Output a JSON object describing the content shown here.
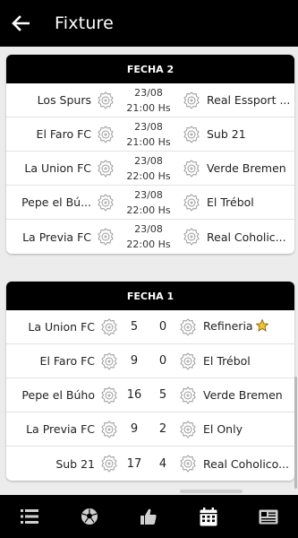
{
  "header": {
    "title": "Fixture",
    "back_icon": "arrow-left-icon"
  },
  "upcoming": {
    "title": "FECHA 2",
    "matches": [
      {
        "home": "Los Spurs",
        "date": "23/08",
        "time": "21:00 Hs",
        "away": "Real Essport ..."
      },
      {
        "home": "El Faro FC",
        "date": "23/08",
        "time": "21:00 Hs",
        "away": "Sub 21"
      },
      {
        "home": "La Union FC",
        "date": "23/08",
        "time": "22:00 Hs",
        "away": "Verde Bremen"
      },
      {
        "home": "Pepe el Bú...",
        "date": "23/08",
        "time": "22:00 Hs",
        "away": "El Trébol"
      },
      {
        "home": "La Previa FC",
        "date": "23/08",
        "time": "22:00 Hs",
        "away": "Real Coholic..."
      }
    ]
  },
  "results": {
    "title": "FECHA 1",
    "matches": [
      {
        "home": "La Union FC",
        "home_score": "5",
        "away_score": "0",
        "away": "Refineria",
        "star": true
      },
      {
        "home": "El Faro FC",
        "home_score": "9",
        "away_score": "0",
        "away": "El Trébol",
        "star": false
      },
      {
        "home": "Pepe el Búho",
        "home_score": "16",
        "away_score": "5",
        "away": "Verde Bremen",
        "star": false
      },
      {
        "home": "La Previa FC",
        "home_score": "9",
        "away_score": "2",
        "away": "El Only",
        "star": false
      },
      {
        "home": "Sub 21",
        "home_score": "17",
        "away_score": "4",
        "away": "Real Coholico...",
        "star": false
      }
    ]
  },
  "nav": {
    "items": [
      {
        "icon": "list-icon",
        "active": false
      },
      {
        "icon": "soccer-ball-icon",
        "active": false
      },
      {
        "icon": "thumbs-up-icon",
        "active": false
      },
      {
        "icon": "calendar-icon",
        "active": true
      },
      {
        "icon": "newspaper-icon",
        "active": false
      }
    ]
  },
  "colors": {
    "header_bg": "#000000",
    "card_bg": "#ffffff",
    "page_bg": "#ececec",
    "star": "#f2c230"
  }
}
